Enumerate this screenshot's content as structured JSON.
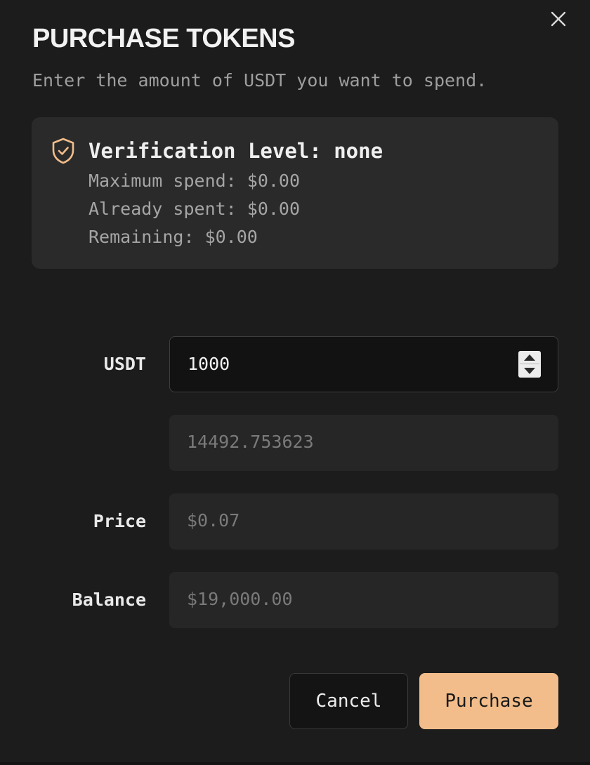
{
  "dialog": {
    "title": "PURCHASE TOKENS",
    "subtitle": "Enter the amount of USDT you want to spend.",
    "close_icon": "close-icon"
  },
  "verification": {
    "icon": "shield-check-icon",
    "accent_color": "#f2bd8a",
    "heading": "Verification Level: none",
    "stats": [
      "Maximum spend: $0.00",
      "Already spent: $0.00",
      "Remaining: $0.00"
    ]
  },
  "form": {
    "usdt": {
      "label": "USDT",
      "value": "1000"
    },
    "tokens": {
      "label": "",
      "value": "14492.753623"
    },
    "price": {
      "label": "Price",
      "value": "$0.07"
    },
    "balance": {
      "label": "Balance",
      "value": "$19,000.00"
    }
  },
  "actions": {
    "cancel_label": "Cancel",
    "purchase_label": "Purchase",
    "purchase_color": "#f2bd8a"
  }
}
